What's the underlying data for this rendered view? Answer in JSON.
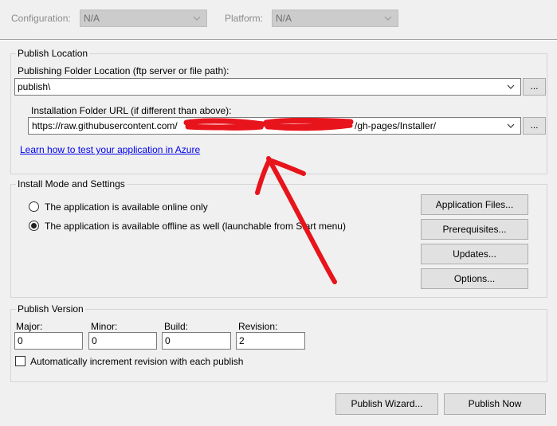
{
  "config_row": {
    "configuration_label": "Configuration:",
    "configuration_value": "N/A",
    "platform_label": "Platform:",
    "platform_value": "N/A"
  },
  "publish_location": {
    "title": "Publish Location",
    "folder_label": "Publishing Folder Location (ftp server or file path):",
    "folder_value": "publish\\",
    "browse_label": "...",
    "install_label": "Installation Folder URL (if different than above):",
    "install_value_prefix": "https://raw.githubusercontent.com/",
    "install_value_suffix": "/gh-pages/Installer/",
    "install_browse_label": "...",
    "azure_link": "Learn how to test your application in Azure"
  },
  "install_mode": {
    "title": "Install Mode and Settings",
    "radio_online": "The application is available online only",
    "radio_offline": "The application is available offline as well (launchable from Start menu)",
    "selected": "offline",
    "buttons": {
      "app_files": "Application Files...",
      "prerequisites": "Prerequisites...",
      "updates": "Updates...",
      "options": "Options..."
    }
  },
  "publish_version": {
    "title": "Publish Version",
    "major_label": "Major:",
    "major_value": "0",
    "minor_label": "Minor:",
    "minor_value": "0",
    "build_label": "Build:",
    "build_value": "0",
    "revision_label": "Revision:",
    "revision_value": "2",
    "auto_increment_label": "Automatically increment revision with each publish",
    "auto_increment_checked": false
  },
  "footer": {
    "wizard": "Publish Wizard...",
    "publish_now": "Publish Now"
  },
  "colors": {
    "annotation": "#e8141c",
    "link": "#0000ee",
    "button_face": "#e1e1e1"
  }
}
